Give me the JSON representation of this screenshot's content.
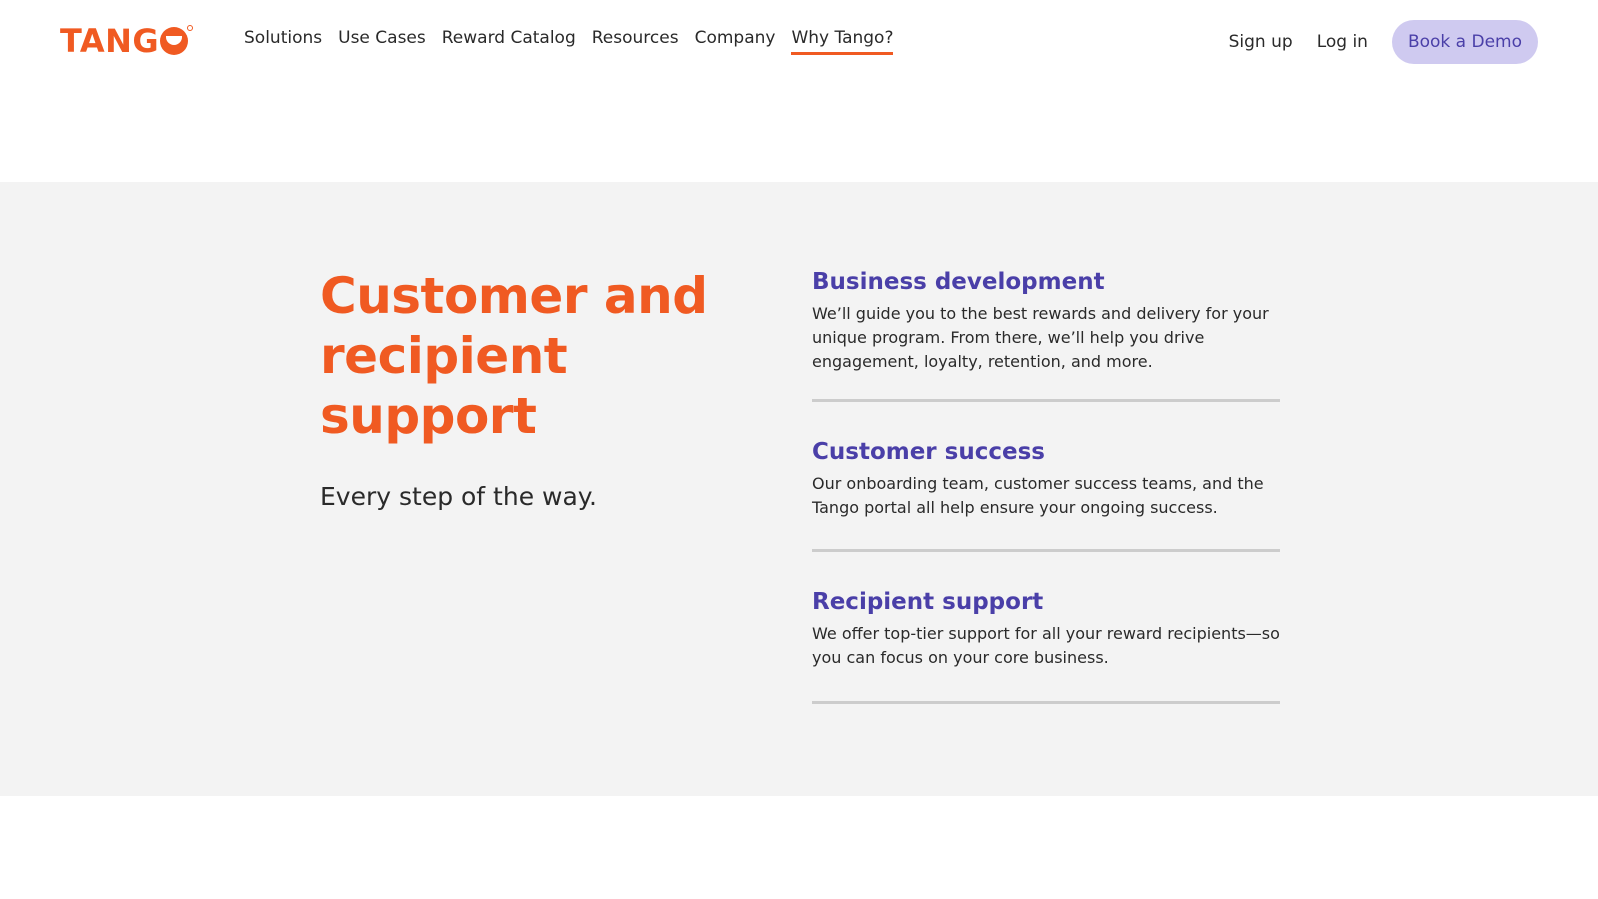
{
  "header": {
    "logo_text": "TANG",
    "nav": [
      {
        "label": "Solutions"
      },
      {
        "label": "Use Cases"
      },
      {
        "label": "Reward Catalog"
      },
      {
        "label": "Resources"
      },
      {
        "label": "Company"
      },
      {
        "label": "Why Tango?"
      }
    ],
    "active_nav": "Why Tango?",
    "signup_label": "Sign up",
    "login_label": "Log in",
    "demo_label": "Book a Demo"
  },
  "hero": {
    "title": "Customer and recipient support",
    "subtitle": "Every step of the way."
  },
  "features": [
    {
      "title": "Business development",
      "description": "We’ll guide you to the best rewards and delivery for your unique program. From there, we’ll help you drive engagement, loyalty, retention, and more."
    },
    {
      "title": "Customer success",
      "description": "Our onboarding team, customer success teams, and the Tango portal all help ensure your ongoing success."
    },
    {
      "title": "Recipient support",
      "description": "We offer top-tier support for all your reward recipients—so you can focus on your core business."
    }
  ],
  "colors": {
    "brand_orange": "#f05a22",
    "accent_purple": "#4a3fa8",
    "button_bg": "#cfcaf0",
    "band_bg": "#f3f3f3"
  }
}
